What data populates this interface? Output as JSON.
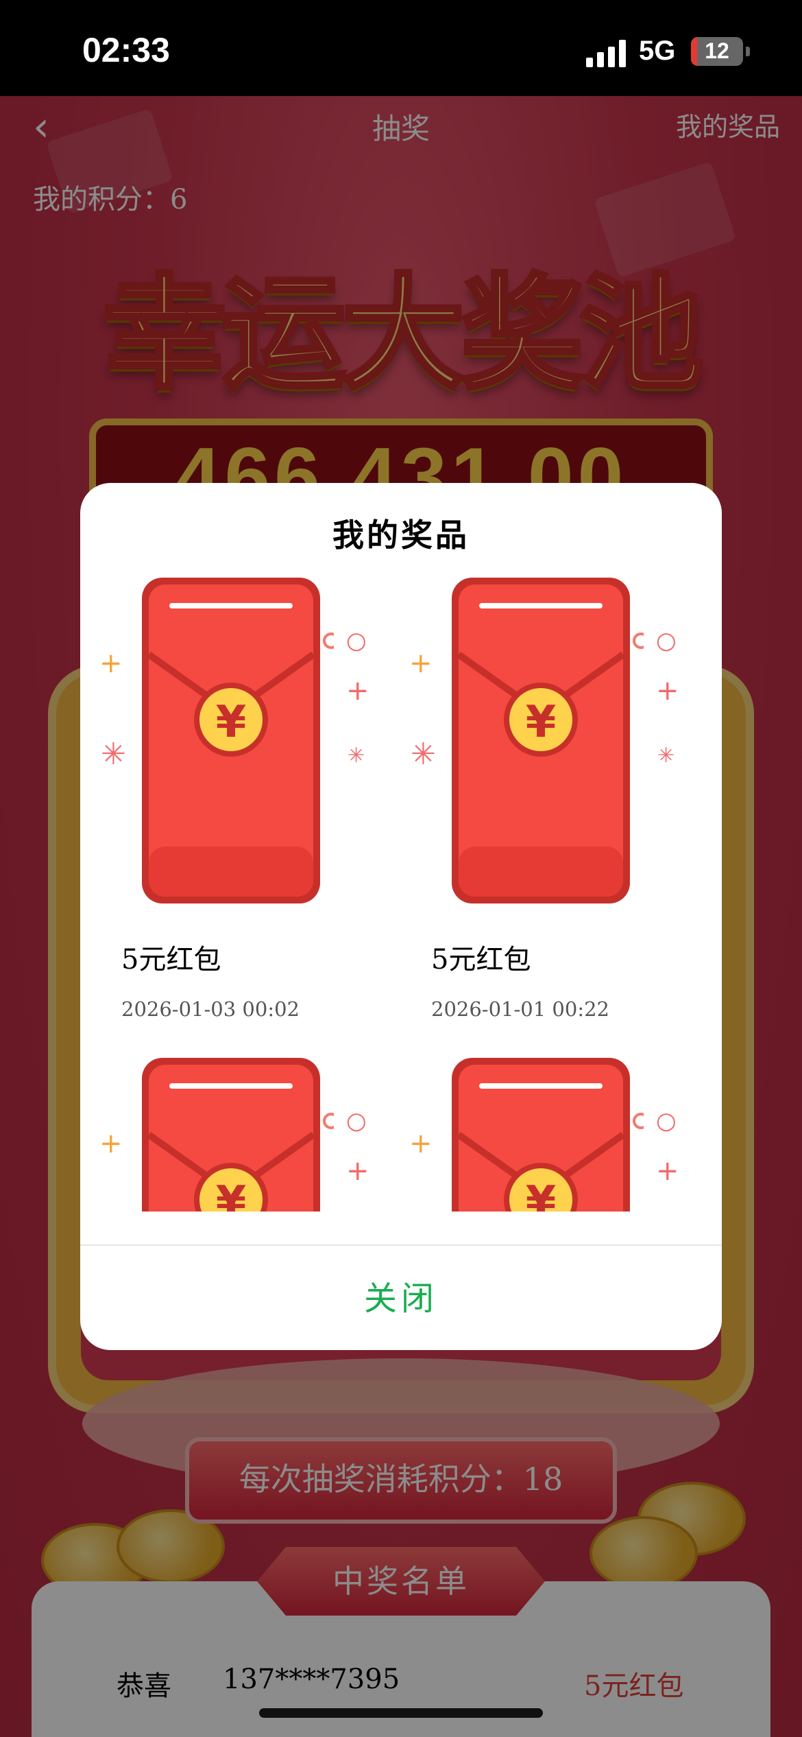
{
  "status_bar": {
    "time": "02:33",
    "network": "5G",
    "battery": "12"
  },
  "nav": {
    "back_icon": "chevron-left-icon",
    "title": "抽奖",
    "right_link": "我的奖品"
  },
  "points_label": "我的积分：6",
  "banner_title": "幸运大奖池",
  "jackpot_amount": "466,431.00",
  "cost_label": "每次抽奖消耗积分：18",
  "winner_list": {
    "title": "中奖名单",
    "rows": [
      {
        "prefix": "恭喜",
        "phone": "137****7395",
        "prize": "5元红包"
      }
    ]
  },
  "modal": {
    "title": "我的奖品",
    "prizes": [
      {
        "name": "5元红包",
        "date": "2026-01-03 00:02",
        "icon": "red-envelope-icon"
      },
      {
        "name": "5元红包",
        "date": "2026-01-01 00:22",
        "icon": "red-envelope-icon"
      },
      {
        "name": "",
        "date": "",
        "icon": "red-envelope-icon"
      },
      {
        "name": "",
        "date": "",
        "icon": "red-envelope-icon"
      }
    ],
    "close_label": "关闭"
  },
  "colors": {
    "accent_green": "#1aad50",
    "envelope_red": "#f44a41",
    "coin_gold": "#ffd24d"
  }
}
